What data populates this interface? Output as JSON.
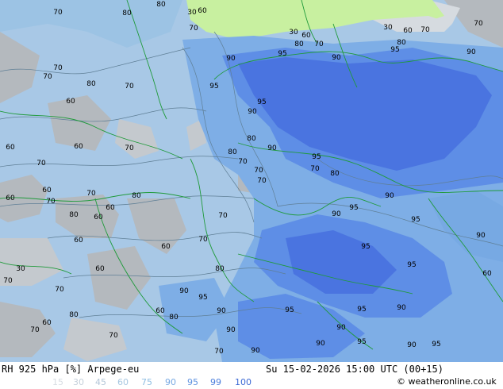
{
  "footer": {
    "left": "RH 925 hPa [%] Arpege-eu",
    "center": "Su 15-02-2026 15:00 UTC (00+15)",
    "credit": "© weatheronline.co.uk"
  },
  "legend": {
    "values": [
      "15",
      "30",
      "45",
      "60",
      "75",
      "90",
      "95",
      "99",
      "100"
    ],
    "colors": [
      "#d8dde3",
      "#c5d0db",
      "#b3c6d8",
      "#a7c7e1",
      "#8fbfe3",
      "#77a9e3",
      "#5e92e0",
      "#4b7fdc",
      "#3a68d4"
    ]
  },
  "palette": {
    "sea_dry": "#a8c8e6",
    "low": "#b4b9be",
    "dry_light": "#d6dbe0",
    "mid": "#9cc3e4",
    "moist": "#7eaee6",
    "very_moist": "#5e8ee6",
    "saturated": "#4a74e0",
    "yellowgreen": "#c8f0a0",
    "contour": "#5f7f96",
    "border": "#1f9a3a"
  },
  "contour_labels": [
    {
      "t": "70"
    },
    {
      "t": "80"
    },
    {
      "t": "80"
    },
    {
      "t": "30"
    },
    {
      "t": "60"
    },
    {
      "t": "70"
    },
    {
      "t": "30"
    },
    {
      "t": "60"
    },
    {
      "t": "80"
    },
    {
      "t": "70"
    },
    {
      "t": "30"
    },
    {
      "t": "60"
    },
    {
      "t": "70"
    },
    {
      "t": "70"
    },
    {
      "t": "90"
    },
    {
      "t": "95"
    },
    {
      "t": "90"
    },
    {
      "t": "95"
    },
    {
      "t": "80"
    },
    {
      "t": "90"
    },
    {
      "t": "70"
    },
    {
      "t": "70"
    },
    {
      "t": "80"
    },
    {
      "t": "70"
    },
    {
      "t": "95"
    },
    {
      "t": "60"
    },
    {
      "t": "95"
    },
    {
      "t": "90"
    },
    {
      "t": "80"
    },
    {
      "t": "90"
    },
    {
      "t": "80"
    },
    {
      "t": "70"
    },
    {
      "t": "60"
    },
    {
      "t": "70"
    },
    {
      "t": "60"
    },
    {
      "t": "70"
    },
    {
      "t": "70"
    },
    {
      "t": "95"
    },
    {
      "t": "70"
    },
    {
      "t": "80"
    },
    {
      "t": "60"
    },
    {
      "t": "70"
    },
    {
      "t": "80"
    },
    {
      "t": "60"
    },
    {
      "t": "70"
    },
    {
      "t": "90"
    },
    {
      "t": "60"
    },
    {
      "t": "70"
    },
    {
      "t": "95"
    },
    {
      "t": "90"
    },
    {
      "t": "95"
    },
    {
      "t": "70"
    },
    {
      "t": "95"
    },
    {
      "t": "80"
    },
    {
      "t": "90"
    },
    {
      "t": "60"
    },
    {
      "t": "60"
    },
    {
      "t": "30"
    },
    {
      "t": "60"
    },
    {
      "t": "60"
    },
    {
      "t": "80"
    },
    {
      "t": "95"
    },
    {
      "t": "70"
    },
    {
      "t": "70"
    },
    {
      "t": "90"
    },
    {
      "t": "95"
    },
    {
      "t": "70"
    },
    {
      "t": "80"
    },
    {
      "t": "60"
    },
    {
      "t": "95"
    },
    {
      "t": "90"
    },
    {
      "t": "95"
    },
    {
      "t": "60"
    },
    {
      "t": "90"
    },
    {
      "t": "70"
    },
    {
      "t": "90"
    },
    {
      "t": "90"
    },
    {
      "t": "70"
    },
    {
      "t": "90"
    },
    {
      "t": "95"
    },
    {
      "t": "90"
    },
    {
      "t": "80"
    },
    {
      "t": "70"
    },
    {
      "t": "90"
    },
    {
      "t": "95"
    },
    {
      "t": "60"
    }
  ]
}
